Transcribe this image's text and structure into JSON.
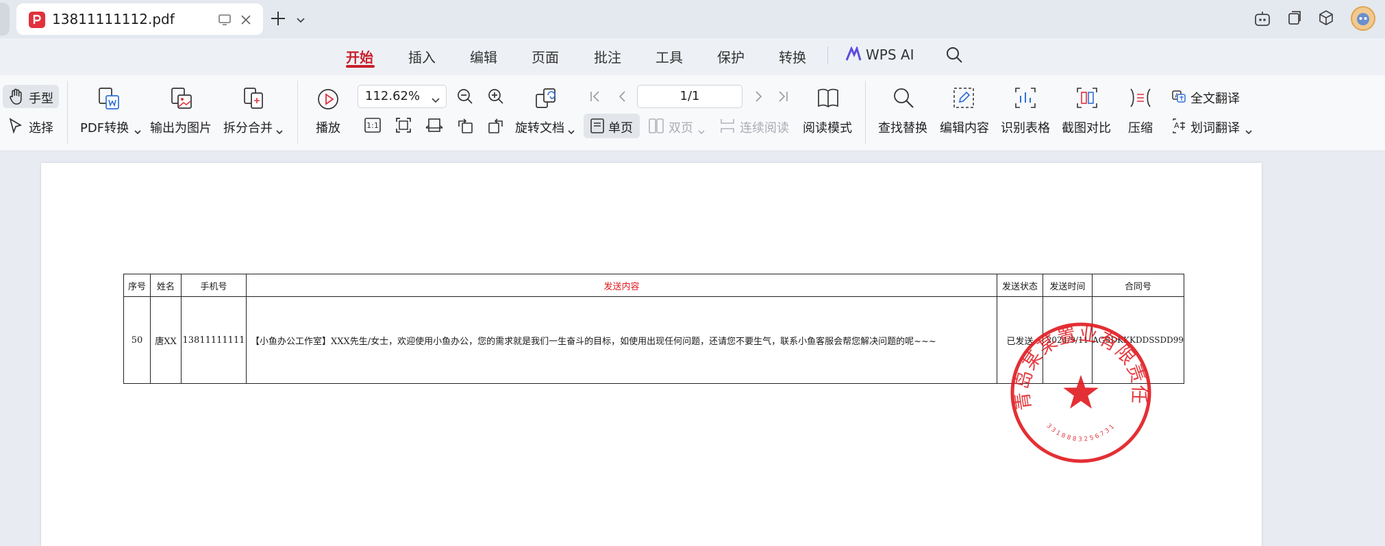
{
  "tab": {
    "title": "13811111112.pdf"
  },
  "menu": [
    "开始",
    "插入",
    "编辑",
    "页面",
    "批注",
    "工具",
    "保护",
    "转换",
    "WPS AI"
  ],
  "ribbon": {
    "hand": "手型",
    "select": "选择",
    "pdf_convert": "PDF转换",
    "export_image": "输出为图片",
    "split_merge": "拆分合并",
    "play": "播放",
    "zoom": "112.62%",
    "rotate": "旋转文档",
    "page": "1/1",
    "single": "单页",
    "double": "双页",
    "continuous": "连续阅读",
    "read_mode": "阅读模式",
    "find_replace": "查找替换",
    "edit_content": "编辑内容",
    "ocr_table": "识别表格",
    "screenshot_compare": "截图对比",
    "compress": "压缩",
    "full_translate": "全文翻译",
    "word_translate": "划词翻译",
    "fit_actual": "1:1"
  },
  "table": {
    "headers": [
      "序号",
      "姓名",
      "手机号",
      "发送内容",
      "发送状态",
      "发送时间",
      "合同号"
    ],
    "row": [
      "50",
      "唐XX",
      "13811111111",
      "【小鱼办公工作室】XXX先生/女士，欢迎使用小鱼办公，您的需求就是我们一生奋斗的目标，如使用出现任何问题，还请您不要生气，联系小鱼客服会帮您解决问题的呢~~~",
      "已发送",
      "2024/9/11",
      "AGSDKKKDDSSDD99"
    ]
  },
  "seal": {
    "text": "青岛某某置业有限责任公司",
    "number": "3318883256731"
  },
  "colors": {
    "accent": "#c8202b",
    "seal": "#e0191f"
  }
}
